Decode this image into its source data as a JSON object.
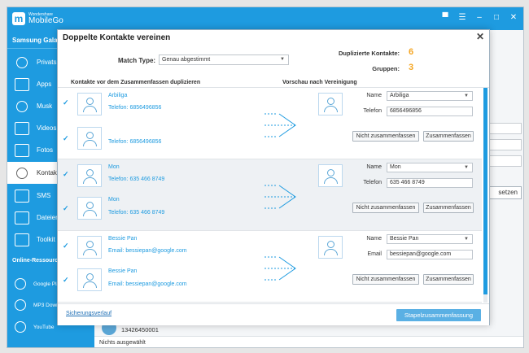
{
  "app": {
    "brand_small": "Wondershare",
    "brand": "MobileGo",
    "device": "Samsung Galaxy"
  },
  "sidebar": {
    "items": [
      {
        "label": "Privatsph",
        "icon": "search-icon"
      },
      {
        "label": "Apps",
        "icon": "apps-icon"
      },
      {
        "label": "Musk",
        "icon": "music-icon"
      },
      {
        "label": "Videos",
        "icon": "video-icon"
      },
      {
        "label": "Fotos",
        "icon": "photo-icon"
      },
      {
        "label": "Kontakte",
        "icon": "contacts-icon"
      },
      {
        "label": "SMS",
        "icon": "sms-icon"
      },
      {
        "label": "Dateien",
        "icon": "folder-icon"
      },
      {
        "label": "Toolkit",
        "icon": "toolkit-icon"
      }
    ],
    "online_section": "Online-Ressourcen",
    "online_items": [
      {
        "label": "Google Pla",
        "icon": "google-play-icon"
      },
      {
        "label": "MP3 Down",
        "icon": "mp3-icon"
      },
      {
        "label": "YouTube",
        "icon": "youtube-icon"
      }
    ]
  },
  "background": {
    "button_label": "setzen",
    "contact_number": "13426450001",
    "status": "Nichts ausgewählt"
  },
  "dialog": {
    "title": "Doppelte Kontakte vereinen",
    "match_label": "Match Type:",
    "match_value": "Genau abgestimmt",
    "duplicates_label": "Duplizierte Kontakte:",
    "duplicates_value": "6",
    "groups_label": "Gruppen:",
    "groups_value": "3",
    "col_left": "Kontakte vor dem Zusammenfassen duplizieren",
    "col_right": "Vorschau nach Vereinigung",
    "field_name": "Name",
    "field_phone": "Telefon",
    "field_email": "Email",
    "btn_skip": "Nicht zusammenfassen",
    "btn_merge": "Zusammenfassen",
    "backup_link": "Sicherungsverlauf",
    "batch_button": "Stapelzusammenfassung",
    "groups": [
      {
        "contacts": [
          {
            "name": "Arbiliga",
            "detail": "Telefon: 6856496856"
          },
          {
            "name": "",
            "detail": "Telefon: 6856496856"
          }
        ],
        "preview_name": "Arbiliga",
        "preview_value": "6856496856"
      },
      {
        "contacts": [
          {
            "name": "Mon",
            "detail": "Telefon: 635 466 8749"
          },
          {
            "name": "Mon",
            "detail": "Telefon: 635 466 8749"
          }
        ],
        "preview_name": "Mon",
        "preview_value": "635 466 8749"
      },
      {
        "contacts": [
          {
            "name": "Bessie Pan",
            "detail": "Email: bessiepan@google.com"
          },
          {
            "name": "Bessie Pan",
            "detail": "Email: bessiepan@google.com"
          }
        ],
        "preview_name": "Bessie Pan",
        "preview_value": "bessiepan@google.com"
      }
    ]
  }
}
